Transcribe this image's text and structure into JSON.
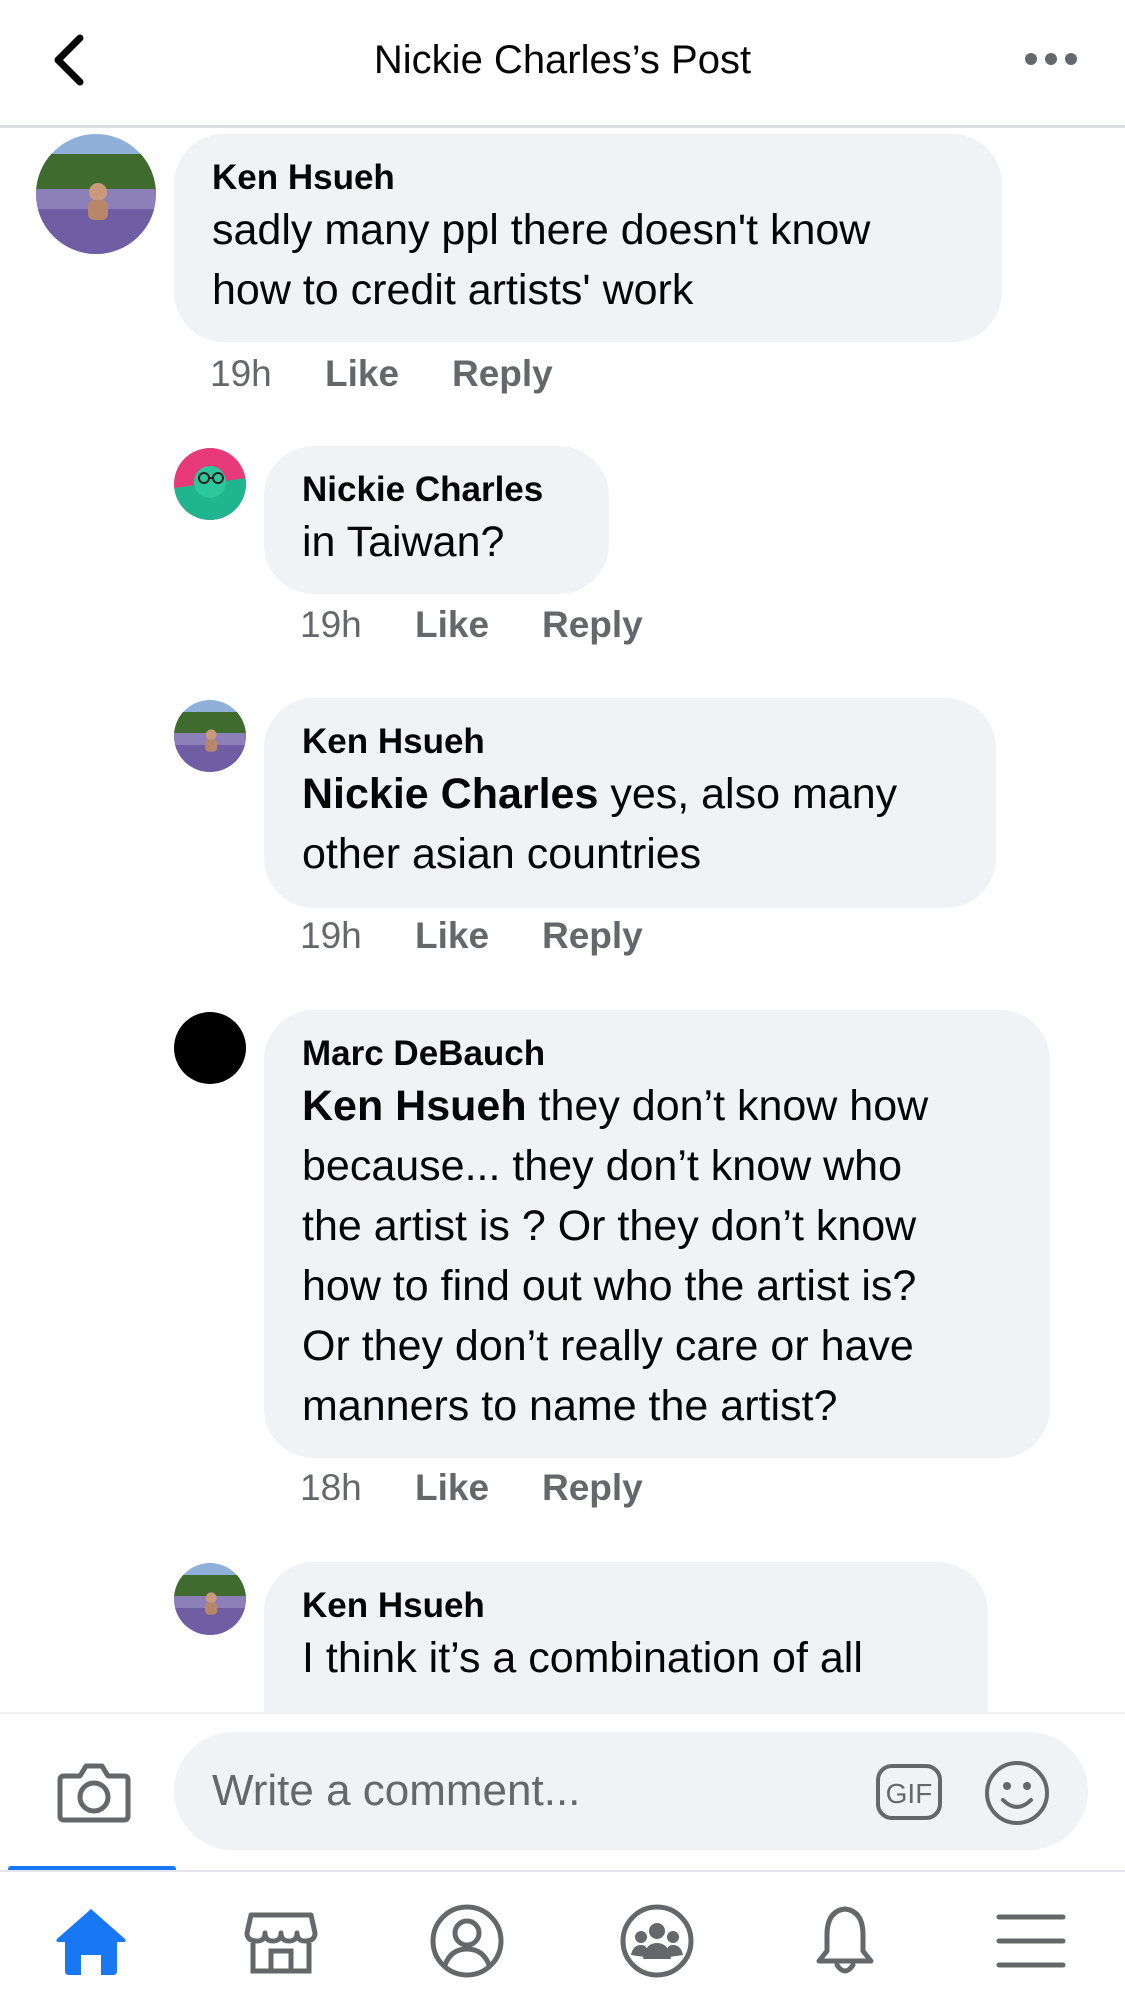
{
  "header": {
    "title": "Nickie Charles’s Post",
    "back_icon": "chevron-left-icon",
    "more_icon": "more-horizontal-icon"
  },
  "comments": [
    {
      "author": "Ken Hsueh",
      "lines": [
        "sadly many ppl there doesn't know",
        "how to credit artists' work"
      ],
      "time": "19h",
      "like": "Like",
      "reply": "Reply"
    },
    {
      "author": "Nickie Charles",
      "lines": [
        "in Taiwan?"
      ],
      "time": "19h",
      "like": "Like",
      "reply": "Reply"
    },
    {
      "author": "Ken Hsueh",
      "mention": "Nickie Charles",
      "lines": [
        " yes, also many",
        "other asian countries"
      ],
      "time": "19h",
      "like": "Like",
      "reply": "Reply"
    },
    {
      "author": "Marc DeBauch",
      "mention": "Ken Hsueh",
      "lines": [
        " they don’t know how",
        "because... they don’t know who",
        "the artist is ? Or they don’t know",
        "how to find out who the artist is?",
        "Or they don’t really care or have",
        "manners to name the artist?"
      ],
      "time": "18h",
      "like": "Like",
      "reply": "Reply"
    },
    {
      "author": "Ken Hsueh",
      "lines": [
        "I think it’s a combination of all"
      ]
    }
  ],
  "composer": {
    "placeholder": "Write a comment...",
    "camera_icon": "camera-icon",
    "gif_label": "GIF",
    "emoji_icon": "emoji-icon"
  },
  "bottom_nav": {
    "items": [
      "home-icon",
      "marketplace-icon",
      "profile-icon",
      "groups-icon",
      "notifications-icon",
      "menu-icon"
    ],
    "active": "home-icon",
    "accent": "#1877f2"
  }
}
